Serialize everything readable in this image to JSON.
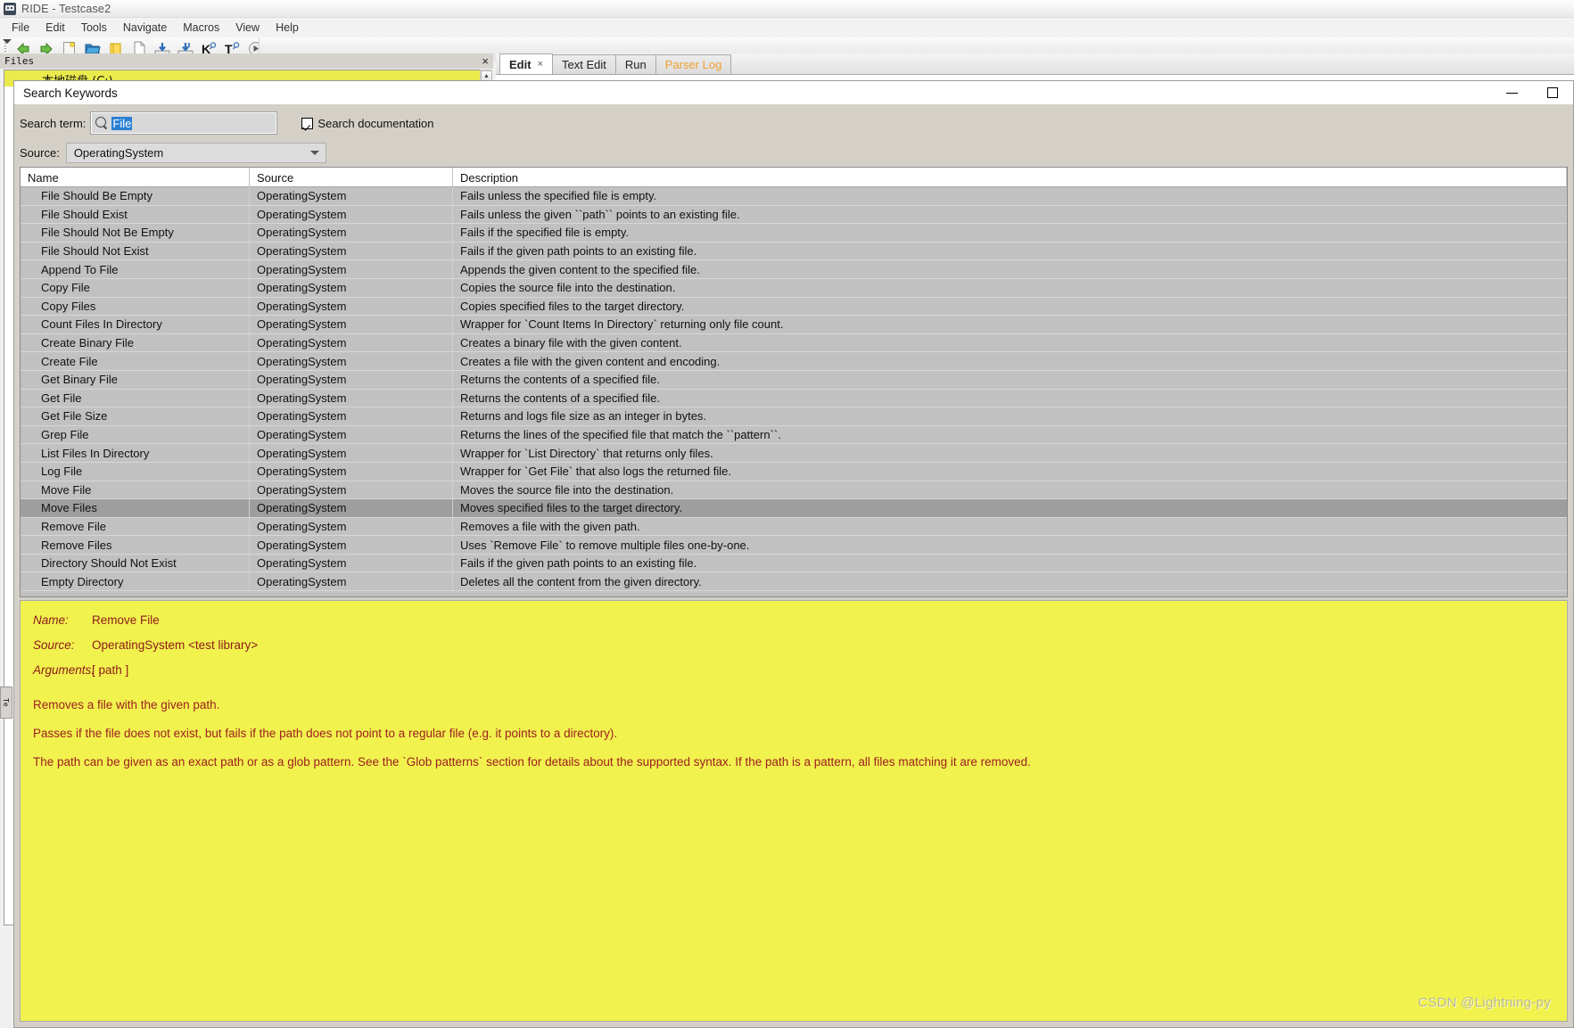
{
  "window": {
    "title": "RIDE - Testcase2",
    "icon": "robot-icon"
  },
  "menubar": {
    "items": [
      "File",
      "Edit",
      "Tools",
      "Navigate",
      "Macros",
      "View",
      "Help"
    ]
  },
  "toolbar": {
    "buttons": [
      {
        "name": "back-arrow-icon",
        "glyph": "back"
      },
      {
        "name": "forward-arrow-icon",
        "glyph": "forward"
      },
      {
        "name": "new-project-icon",
        "glyph": "newproject"
      },
      {
        "name": "open-folder-icon",
        "glyph": "openfolder"
      },
      {
        "name": "open-directory-icon",
        "glyph": "folder"
      },
      {
        "name": "new-file-icon",
        "glyph": "page"
      },
      {
        "name": "save-icon",
        "glyph": "save"
      },
      {
        "name": "save-all-icon",
        "glyph": "saveall"
      },
      {
        "name": "search-keyword-icon",
        "glyph": "K"
      },
      {
        "name": "search-tests-icon",
        "glyph": "T"
      },
      {
        "name": "run-icon",
        "glyph": "run"
      },
      {
        "name": "debug-icon",
        "glyph": "bug"
      },
      {
        "name": "stop-icon",
        "glyph": "stop"
      }
    ]
  },
  "files_pane": {
    "title": "Files",
    "close_label": "×",
    "tree_selected_label": "本地磁盘 (C:)"
  },
  "left_vertical_tab": {
    "label": "Te"
  },
  "editor": {
    "tabs": [
      {
        "label": "Edit",
        "active": true,
        "closable": true,
        "close_label": "×",
        "orange": false
      },
      {
        "label": "Text Edit",
        "active": false,
        "closable": false,
        "orange": false
      },
      {
        "label": "Run",
        "active": false,
        "closable": false,
        "orange": false
      },
      {
        "label": "Parser Log",
        "active": false,
        "closable": false,
        "orange": true
      }
    ]
  },
  "dialog": {
    "title": "Search Keywords",
    "minimize_label": "minimize-icon",
    "maximize_label": "maximize-icon",
    "search": {
      "label": "Search term:",
      "value": "File",
      "icon": "search-icon",
      "checkbox_label": "Search documentation",
      "checkbox_checked": true
    },
    "source": {
      "label": "Source:",
      "value": "OperatingSystem"
    },
    "table": {
      "columns": [
        "Name",
        "Source",
        "Description"
      ],
      "selected_row_index": 17,
      "rows": [
        [
          "File Should Be Empty",
          "OperatingSystem",
          "Fails unless the specified file is empty."
        ],
        [
          "File Should Exist",
          "OperatingSystem",
          "Fails unless the given ``path`` points to an existing file."
        ],
        [
          "File Should Not Be Empty",
          "OperatingSystem",
          "Fails if the specified file is empty."
        ],
        [
          "File Should Not Exist",
          "OperatingSystem",
          "Fails if the given path points to an existing file."
        ],
        [
          "Append To File",
          "OperatingSystem",
          "Appends the given content to the specified file."
        ],
        [
          "Copy File",
          "OperatingSystem",
          "Copies the source file into the destination."
        ],
        [
          "Copy Files",
          "OperatingSystem",
          "Copies specified files to the target directory."
        ],
        [
          "Count Files In Directory",
          "OperatingSystem",
          "Wrapper for `Count Items In Directory` returning only file count."
        ],
        [
          "Create Binary File",
          "OperatingSystem",
          "Creates a binary file with the given content."
        ],
        [
          "Create File",
          "OperatingSystem",
          "Creates a file with the given content and encoding."
        ],
        [
          "Get Binary File",
          "OperatingSystem",
          "Returns the contents of a specified file."
        ],
        [
          "Get File",
          "OperatingSystem",
          "Returns the contents of a specified file."
        ],
        [
          "Get File Size",
          "OperatingSystem",
          "Returns and logs file size as an integer in bytes."
        ],
        [
          "Grep File",
          "OperatingSystem",
          "Returns the lines of the specified file that match the ``pattern``."
        ],
        [
          "List Files In Directory",
          "OperatingSystem",
          "Wrapper for `List Directory` that returns only files."
        ],
        [
          "Log File",
          "OperatingSystem",
          "Wrapper for `Get File` that also logs the returned file."
        ],
        [
          "Move File",
          "OperatingSystem",
          "Moves the source file into the destination."
        ],
        [
          "Move Files",
          "OperatingSystem",
          "Moves specified files to the target directory."
        ],
        [
          "Remove File",
          "OperatingSystem",
          "Removes a file with the given path."
        ],
        [
          "Remove Files",
          "OperatingSystem",
          "Uses `Remove File` to remove multiple files one-by-one."
        ],
        [
          "Directory Should Not Exist",
          "OperatingSystem",
          "Fails if the given path points to an existing file."
        ],
        [
          "Empty Directory",
          "OperatingSystem",
          "Deletes all the content from the given directory."
        ]
      ]
    },
    "documentation": {
      "name_label": "Name:",
      "name_value": "Remove File",
      "source_label": "Source:",
      "source_value": "OperatingSystem <test library>",
      "arguments_label": "Arguments:",
      "arguments_value": "[ path ]",
      "paragraphs": [
        "Removes a file with the given path.",
        "Passes if the file does not exist, but fails if the path does not point to a regular file (e.g. it points to a directory).",
        "The path can be given as an exact path or as a glob pattern. See the `Glob patterns` section for details about the supported syntax. If the path is a pattern, all files matching it are removed."
      ]
    }
  },
  "watermark": {
    "text": "CSDN @Lightning-py"
  },
  "colors": {
    "doc_panel_bg": "#f2f24e",
    "doc_text": "#9c2020",
    "selection_blue": "#2a7fd4",
    "tab_orange": "#f0a030",
    "row_selected": "#9e9e9e"
  }
}
